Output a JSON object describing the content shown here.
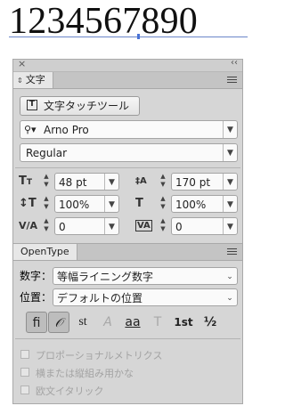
{
  "sample_text": "1234567890",
  "panel": {
    "tab_label": "文字",
    "tab_glyph": "⇕",
    "close": "×",
    "collapse": "‹‹",
    "touch_tool_label": "文字タッチツール",
    "font_family": "Arno Pro",
    "font_style": "Regular",
    "font_size": "48 pt",
    "leading": "170 pt",
    "vertical_scale": "100%",
    "horizontal_scale": "100%",
    "kerning": "0",
    "tracking": "0"
  },
  "opentype": {
    "tab_label": "OpenType",
    "figure_label": "数字：",
    "figure_value": "等幅ライニング数字",
    "position_label": "位置：",
    "position_value": "デフォルトの位置",
    "glyphs": [
      "ﬁ",
      "𝒪",
      "st",
      "A",
      "aa",
      "T",
      "1st",
      "½"
    ],
    "options": [
      "プロポーショナルメトリクス",
      "横または縦組み用かな",
      "欧文イタリック"
    ]
  },
  "icons": [
    "close-icon",
    "collapse-icon",
    "menu-icon",
    "touch-type-icon",
    "search-icon",
    "chevron-down-icon",
    "font-size-icon",
    "leading-icon",
    "vertical-scale-icon",
    "horizontal-scale-icon",
    "kerning-icon",
    "tracking-icon"
  ],
  "colors": {
    "panel_bg": "#d6d6d6",
    "caret": "#4a73d6",
    "baseline": "#6b86c9"
  }
}
